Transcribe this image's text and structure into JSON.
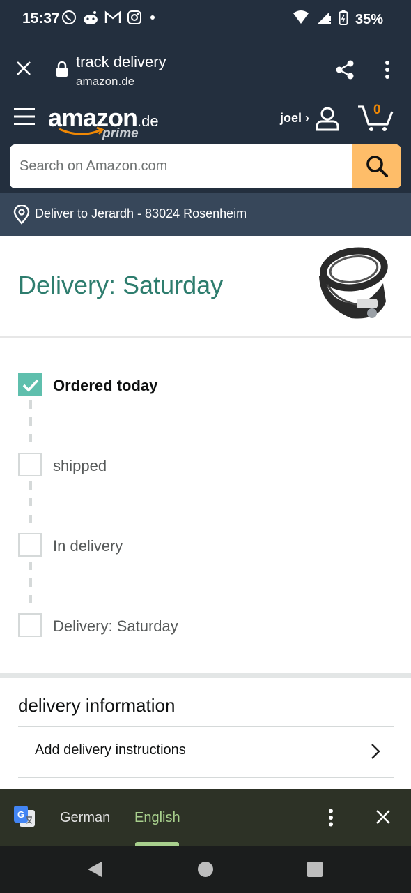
{
  "status_bar": {
    "time": "15:37",
    "battery": "35%",
    "notification_icons": [
      "whatsapp-icon",
      "reddit-icon",
      "gmail-icon",
      "instagram-icon",
      "dot-icon"
    ],
    "system_icons": [
      "wifi-icon",
      "signal-icon",
      "battery-icon"
    ]
  },
  "browser": {
    "title": "track delivery",
    "url": "amazon.de"
  },
  "header": {
    "logo_word": "amazon",
    "logo_tld": ".de",
    "logo_sub": "prime",
    "user_label": "joel ›",
    "cart_count": "0"
  },
  "search": {
    "placeholder": "Search on Amazon.com"
  },
  "deliver_to": {
    "label": "Deliver to Jerardh - 83024 Rosenheim"
  },
  "delivery": {
    "heading": "Delivery: Saturday",
    "steps": [
      {
        "label": "Ordered today",
        "done": true
      },
      {
        "label": "shipped",
        "done": false
      },
      {
        "label": "In delivery",
        "done": false
      },
      {
        "label": "Delivery: Saturday",
        "done": false
      }
    ]
  },
  "delivery_info": {
    "title": "delivery information",
    "add_instructions": "Add delivery instructions"
  },
  "translate_bar": {
    "source_lang": "German",
    "target_lang": "English"
  },
  "colors": {
    "amazon_dark": "#232f3e",
    "deliver_bar": "#37475a",
    "search_button": "#febd69",
    "accent_teal": "#2e7d6e",
    "check_fill": "#5fbfad",
    "cart_orange": "#f08804",
    "translate_green": "#a8d08d"
  }
}
